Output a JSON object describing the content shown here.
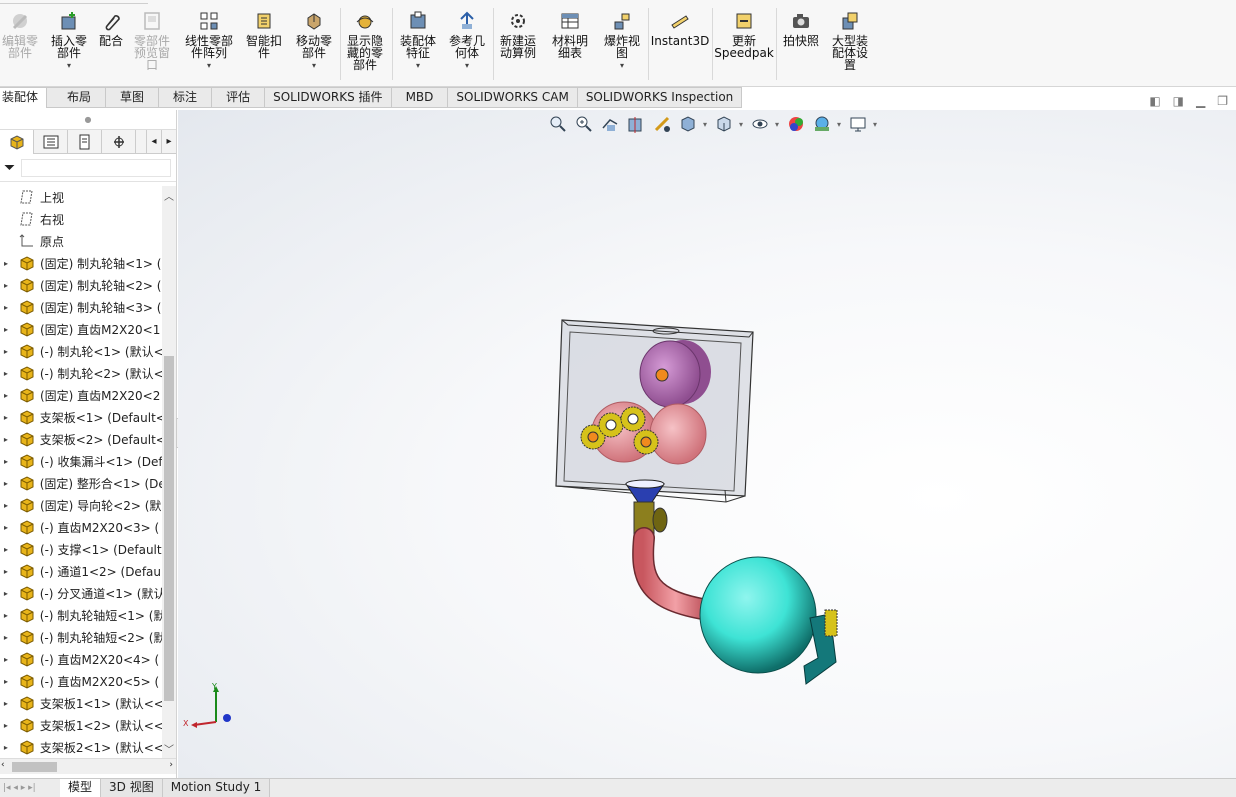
{
  "toolbar": {
    "edit_component": "编辑零\n部件",
    "insert_component": "插入零\n部件",
    "mate": "配合",
    "component_preview": "零部件\n预览窗\n口",
    "linear_pattern": "线性零部\n件阵列",
    "smart_fasteners": "智能扣\n件",
    "move_component": "移动零\n部件",
    "show_hidden": "显示隐\n藏的零\n部件",
    "assembly_features": "装配体\n特征",
    "reference_geometry": "参考几\n何体",
    "new_motion_study": "新建运\n动算例",
    "bom": "材料明\n细表",
    "exploded_view": "爆炸视\n图",
    "instant3d": "Instant3D",
    "update_speedpak": "更新\nSpeedpak",
    "take_snapshot": "拍快照",
    "large_assembly": "大型装\n配体设\n置"
  },
  "tabs": [
    "装配体",
    "布局",
    "草图",
    "标注",
    "评估",
    "SOLIDWORKS 插件",
    "MBD",
    "SOLIDWORKS CAM",
    "SOLIDWORKS Inspection"
  ],
  "tree": {
    "planes": [
      "上视",
      "右视"
    ],
    "origin": "原点",
    "items": [
      "(固定) 制丸轮轴<1> (",
      "(固定) 制丸轮轴<2> (",
      "(固定) 制丸轮轴<3> (",
      "(固定) 直齿M2X20<1",
      "(-) 制丸轮<1> (默认<",
      "(-) 制丸轮<2> (默认<",
      "(固定) 直齿M2X20<2",
      "支架板<1> (Default<",
      "支架板<2> (Default<",
      "(-) 收集漏斗<1> (Def",
      "(固定) 整形合<1> (De",
      "(固定) 导向轮<2> (默",
      "(-) 直齿M2X20<3> (",
      "(-) 支撑<1> (Default",
      "(-) 通道1<2> (Defaul",
      "(-) 分叉通道<1> (默认",
      "(-) 制丸轮轴短<1> (默",
      "(-) 制丸轮轴短<2> (默",
      "(-) 直齿M2X20<4> (",
      "(-) 直齿M2X20<5> (",
      "支架板1<1> (默认<<",
      "支架板1<2> (默认<<",
      "支架板2<1> (默认<<"
    ]
  },
  "triad": {
    "x": "X",
    "y": "Y"
  },
  "bottom_tabs": [
    "模型",
    "3D 视图",
    "Motion Study 1"
  ],
  "colors": {
    "accent": "#0a5fb4",
    "part_icon": "#e8b41a",
    "ball": "#3ee3d5",
    "gear": "#d6c21a",
    "pink": "#e58f96",
    "purple": "#b877b8"
  }
}
